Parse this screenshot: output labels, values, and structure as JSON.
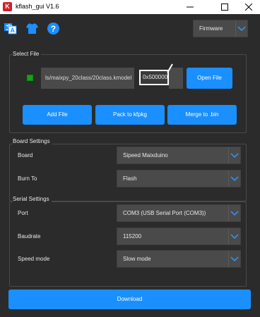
{
  "window": {
    "title": "kflash_gui V1.6",
    "app_icon_letter": "K"
  },
  "toolbar": {
    "firmware_select": "Firmware"
  },
  "select_file": {
    "title": "Select File",
    "path": "ls/maixpy_20class/20class.kmodel",
    "address": "0x500000",
    "open_file": "Open File",
    "add_file": "Add File",
    "pack_kfpkg": "Pack to kfpkg",
    "merge_bin": "Merge to .bin"
  },
  "board_settings": {
    "title": "Board Settings",
    "board_label": "Board",
    "board_value": "Sipeed Maixduino",
    "burn_to_label": "Burn To",
    "burn_to_value": "Flash"
  },
  "serial_settings": {
    "title": "Serial Settings",
    "port_label": "Port",
    "port_value": "COM3 (USB Serial Port (COM3))",
    "baudrate_label": "Baudrate",
    "baudrate_value": "115200",
    "speed_label": "Speed mode",
    "speed_value": "Slow mode"
  },
  "actions": {
    "download": "Download"
  },
  "colors": {
    "accent": "#1a8fff",
    "background": "#2b2b2b",
    "field": "#4a4a4a",
    "status_ok": "#11a511"
  }
}
